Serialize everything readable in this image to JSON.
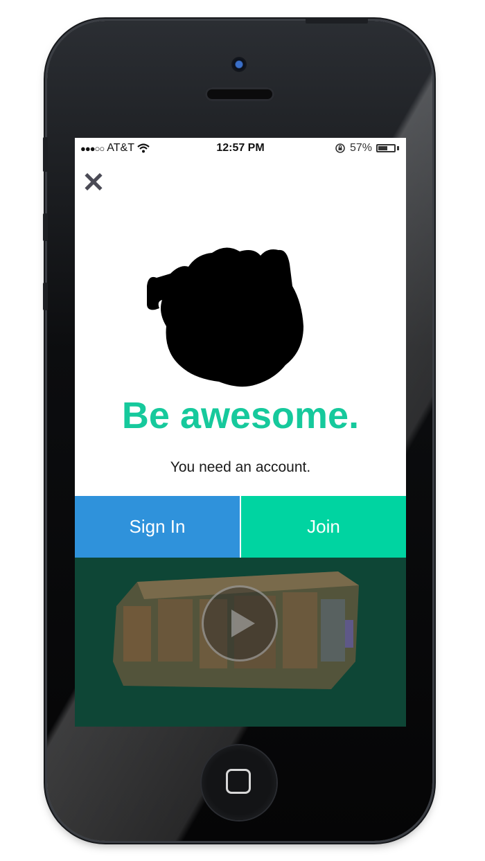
{
  "status_bar": {
    "signal": "●●●○○",
    "carrier": "AT&T",
    "time": "12:57 PM",
    "battery": "57%",
    "battery_level": 0.57
  },
  "close_icon": "close-icon",
  "headline": "Be awesome.",
  "subline": "You need an account.",
  "buttons": {
    "sign_in": "Sign In",
    "join": "Join"
  },
  "video": {
    "play_icon": "play-icon"
  },
  "colors": {
    "headline": "#16c99c",
    "sign_in_bg": "#2f92db",
    "join_bg": "#00d4a1",
    "video_bg": "#0e4636"
  }
}
